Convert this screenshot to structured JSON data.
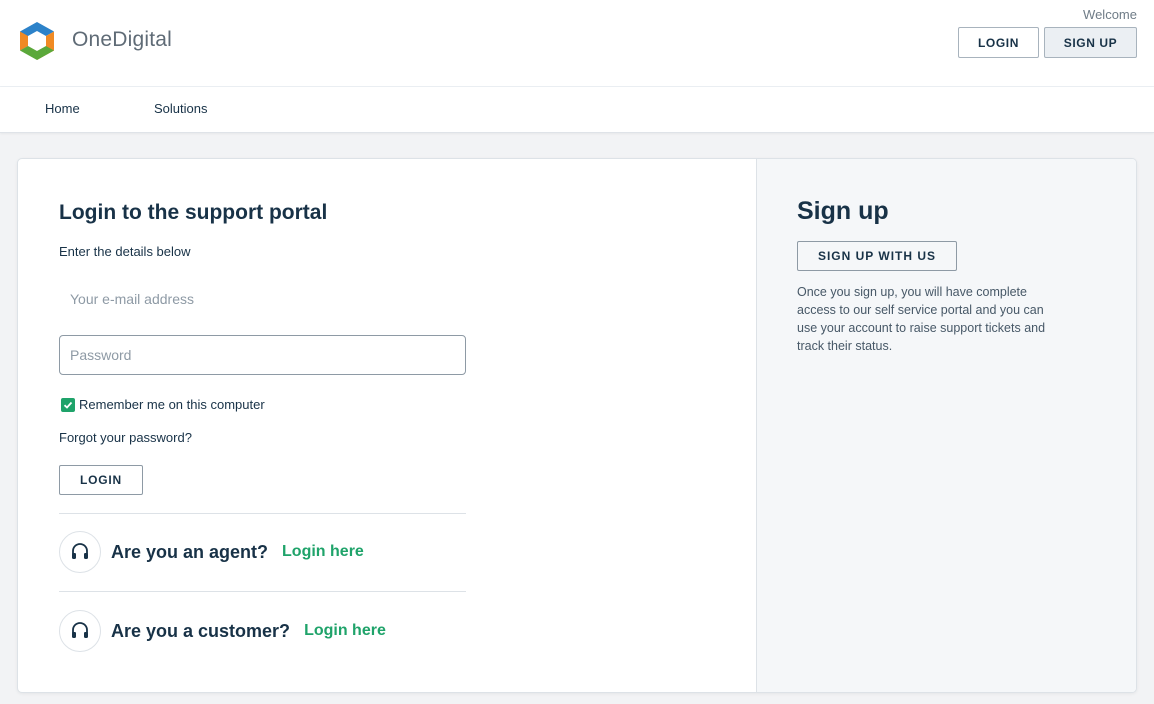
{
  "header": {
    "brand": "OneDigital",
    "welcome": "Welcome",
    "login_label": "LOGIN",
    "signup_label": "SIGN UP"
  },
  "nav": {
    "items": [
      {
        "label": "Home"
      },
      {
        "label": "Solutions"
      }
    ]
  },
  "login": {
    "title": "Login to the support portal",
    "subtitle": "Enter the details below",
    "email_placeholder": "Your e-mail address",
    "password_placeholder": "Password",
    "remember_label": "Remember me on this computer",
    "remember_checked": true,
    "forgot_label": "Forgot your password?",
    "button_label": "LOGIN",
    "agent_text": "Are you an agent?",
    "agent_link": "Login here",
    "customer_text": "Are you a customer?",
    "customer_link": "Login here"
  },
  "signup": {
    "title": "Sign up",
    "button_label": "SIGN UP WITH US",
    "description": "Once you sign up, you will have complete access to our self service portal and you can use your account to raise support tickets and track their status."
  },
  "colors": {
    "accent_green": "#1fa36a",
    "text_dark": "#183247",
    "logo_blue": "#2c82c9",
    "logo_green": "#5ba83a",
    "logo_orange": "#f08a24"
  }
}
